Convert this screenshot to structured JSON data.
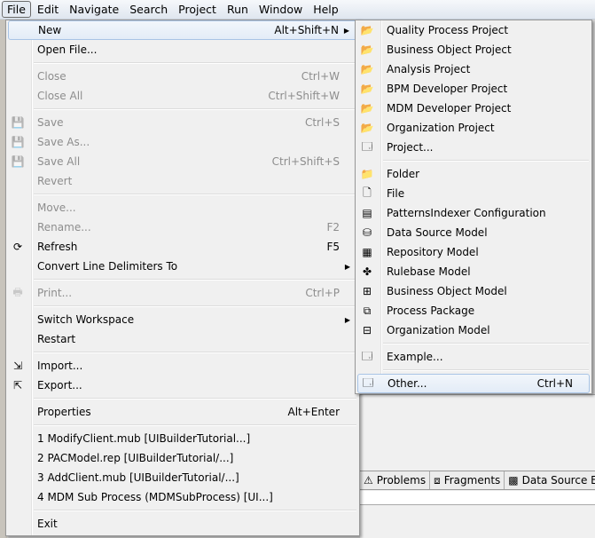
{
  "menubar": [
    "File",
    "Edit",
    "Navigate",
    "Search",
    "Project",
    "Run",
    "Window",
    "Help"
  ],
  "file_menu": [
    {
      "label": "New",
      "shortcut": "Alt+Shift+N",
      "submenu": true,
      "highlight": true
    },
    {
      "label": "Open File..."
    },
    {
      "sep": true
    },
    {
      "label": "Close",
      "shortcut": "Ctrl+W",
      "disabled": true
    },
    {
      "label": "Close All",
      "shortcut": "Ctrl+Shift+W",
      "disabled": true
    },
    {
      "sep": true
    },
    {
      "label": "Save",
      "shortcut": "Ctrl+S",
      "disabled": true,
      "icon": "save-icon"
    },
    {
      "label": "Save As...",
      "disabled": true,
      "icon": "save-as-icon"
    },
    {
      "label": "Save All",
      "shortcut": "Ctrl+Shift+S",
      "disabled": true,
      "icon": "save-all-icon"
    },
    {
      "label": "Revert",
      "disabled": true
    },
    {
      "sep": true
    },
    {
      "label": "Move...",
      "disabled": true
    },
    {
      "label": "Rename...",
      "shortcut": "F2",
      "disabled": true
    },
    {
      "label": "Refresh",
      "shortcut": "F5",
      "icon": "refresh-icon"
    },
    {
      "label": "Convert Line Delimiters To",
      "submenu": true
    },
    {
      "sep": true
    },
    {
      "label": "Print...",
      "shortcut": "Ctrl+P",
      "disabled": true,
      "icon": "print-icon"
    },
    {
      "sep": true
    },
    {
      "label": "Switch Workspace",
      "submenu": true
    },
    {
      "label": "Restart"
    },
    {
      "sep": true
    },
    {
      "label": "Import...",
      "icon": "import-icon"
    },
    {
      "label": "Export...",
      "icon": "export-icon"
    },
    {
      "sep": true
    },
    {
      "label": "Properties",
      "shortcut": "Alt+Enter"
    },
    {
      "sep": true
    },
    {
      "label": "1 ModifyClient.mub  [UIBuilderTutorial...]"
    },
    {
      "label": "2 PACModel.rep  [UIBuilderTutorial/...]"
    },
    {
      "label": "3 AddClient.mub  [UIBuilderTutorial/...]"
    },
    {
      "label": "4 MDM Sub Process (MDMSubProcess)  [UI...]"
    },
    {
      "sep": true
    },
    {
      "label": "Exit"
    }
  ],
  "new_submenu": [
    {
      "label": "Quality Process Project",
      "icon": "project-folder-icon"
    },
    {
      "label": "Business Object Project",
      "icon": "project-folder-icon"
    },
    {
      "label": "Analysis Project",
      "icon": "project-folder-icon"
    },
    {
      "label": "BPM Developer Project",
      "icon": "project-folder-icon"
    },
    {
      "label": "MDM Developer Project",
      "icon": "project-folder-icon"
    },
    {
      "label": "Organization Project",
      "icon": "project-folder-icon"
    },
    {
      "label": "Project...",
      "icon": "new-wizard-icon"
    },
    {
      "sep": true
    },
    {
      "label": "Folder",
      "icon": "folder-icon"
    },
    {
      "label": "File",
      "icon": "file-icon"
    },
    {
      "label": "PatternsIndexer Configuration",
      "icon": "config-icon"
    },
    {
      "label": "Data Source Model",
      "icon": "database-icon"
    },
    {
      "label": "Repository Model",
      "icon": "repository-icon"
    },
    {
      "label": "Rulebase Model",
      "icon": "rulebase-icon"
    },
    {
      "label": "Business Object Model",
      "icon": "bom-icon"
    },
    {
      "label": "Process Package",
      "icon": "process-icon"
    },
    {
      "label": "Organization Model",
      "icon": "org-icon"
    },
    {
      "sep": true
    },
    {
      "label": "Example...",
      "icon": "new-wizard-icon"
    },
    {
      "sep": true
    },
    {
      "label": "Other...",
      "shortcut": "Ctrl+N",
      "icon": "new-wizard-icon",
      "highlight": true
    }
  ],
  "tabs": [
    {
      "label": "Problems",
      "icon": "problems-icon"
    },
    {
      "label": "Fragments",
      "icon": "fragments-icon"
    },
    {
      "label": "Data Source Ex",
      "icon": "data-source-icon"
    }
  ]
}
